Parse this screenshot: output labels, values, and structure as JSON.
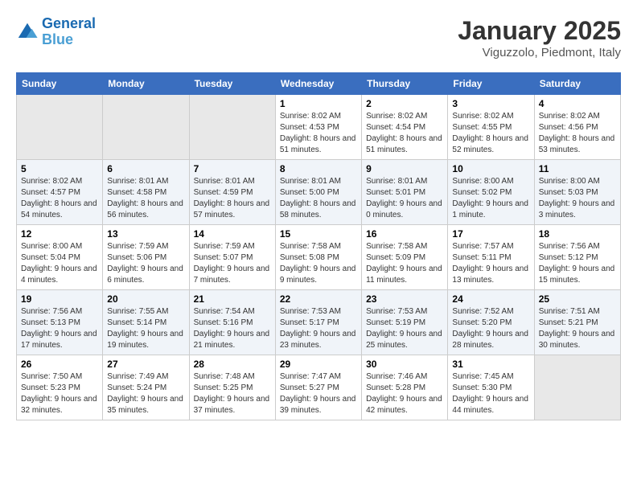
{
  "header": {
    "logo_line1": "General",
    "logo_line2": "Blue",
    "month_title": "January 2025",
    "location": "Viguzzolo, Piedmont, Italy"
  },
  "days_of_week": [
    "Sunday",
    "Monday",
    "Tuesday",
    "Wednesday",
    "Thursday",
    "Friday",
    "Saturday"
  ],
  "weeks": [
    [
      {
        "day": "",
        "info": ""
      },
      {
        "day": "",
        "info": ""
      },
      {
        "day": "",
        "info": ""
      },
      {
        "day": "1",
        "info": "Sunrise: 8:02 AM\nSunset: 4:53 PM\nDaylight: 8 hours and 51 minutes."
      },
      {
        "day": "2",
        "info": "Sunrise: 8:02 AM\nSunset: 4:54 PM\nDaylight: 8 hours and 51 minutes."
      },
      {
        "day": "3",
        "info": "Sunrise: 8:02 AM\nSunset: 4:55 PM\nDaylight: 8 hours and 52 minutes."
      },
      {
        "day": "4",
        "info": "Sunrise: 8:02 AM\nSunset: 4:56 PM\nDaylight: 8 hours and 53 minutes."
      }
    ],
    [
      {
        "day": "5",
        "info": "Sunrise: 8:02 AM\nSunset: 4:57 PM\nDaylight: 8 hours and 54 minutes."
      },
      {
        "day": "6",
        "info": "Sunrise: 8:01 AM\nSunset: 4:58 PM\nDaylight: 8 hours and 56 minutes."
      },
      {
        "day": "7",
        "info": "Sunrise: 8:01 AM\nSunset: 4:59 PM\nDaylight: 8 hours and 57 minutes."
      },
      {
        "day": "8",
        "info": "Sunrise: 8:01 AM\nSunset: 5:00 PM\nDaylight: 8 hours and 58 minutes."
      },
      {
        "day": "9",
        "info": "Sunrise: 8:01 AM\nSunset: 5:01 PM\nDaylight: 9 hours and 0 minutes."
      },
      {
        "day": "10",
        "info": "Sunrise: 8:00 AM\nSunset: 5:02 PM\nDaylight: 9 hours and 1 minute."
      },
      {
        "day": "11",
        "info": "Sunrise: 8:00 AM\nSunset: 5:03 PM\nDaylight: 9 hours and 3 minutes."
      }
    ],
    [
      {
        "day": "12",
        "info": "Sunrise: 8:00 AM\nSunset: 5:04 PM\nDaylight: 9 hours and 4 minutes."
      },
      {
        "day": "13",
        "info": "Sunrise: 7:59 AM\nSunset: 5:06 PM\nDaylight: 9 hours and 6 minutes."
      },
      {
        "day": "14",
        "info": "Sunrise: 7:59 AM\nSunset: 5:07 PM\nDaylight: 9 hours and 7 minutes."
      },
      {
        "day": "15",
        "info": "Sunrise: 7:58 AM\nSunset: 5:08 PM\nDaylight: 9 hours and 9 minutes."
      },
      {
        "day": "16",
        "info": "Sunrise: 7:58 AM\nSunset: 5:09 PM\nDaylight: 9 hours and 11 minutes."
      },
      {
        "day": "17",
        "info": "Sunrise: 7:57 AM\nSunset: 5:11 PM\nDaylight: 9 hours and 13 minutes."
      },
      {
        "day": "18",
        "info": "Sunrise: 7:56 AM\nSunset: 5:12 PM\nDaylight: 9 hours and 15 minutes."
      }
    ],
    [
      {
        "day": "19",
        "info": "Sunrise: 7:56 AM\nSunset: 5:13 PM\nDaylight: 9 hours and 17 minutes."
      },
      {
        "day": "20",
        "info": "Sunrise: 7:55 AM\nSunset: 5:14 PM\nDaylight: 9 hours and 19 minutes."
      },
      {
        "day": "21",
        "info": "Sunrise: 7:54 AM\nSunset: 5:16 PM\nDaylight: 9 hours and 21 minutes."
      },
      {
        "day": "22",
        "info": "Sunrise: 7:53 AM\nSunset: 5:17 PM\nDaylight: 9 hours and 23 minutes."
      },
      {
        "day": "23",
        "info": "Sunrise: 7:53 AM\nSunset: 5:19 PM\nDaylight: 9 hours and 25 minutes."
      },
      {
        "day": "24",
        "info": "Sunrise: 7:52 AM\nSunset: 5:20 PM\nDaylight: 9 hours and 28 minutes."
      },
      {
        "day": "25",
        "info": "Sunrise: 7:51 AM\nSunset: 5:21 PM\nDaylight: 9 hours and 30 minutes."
      }
    ],
    [
      {
        "day": "26",
        "info": "Sunrise: 7:50 AM\nSunset: 5:23 PM\nDaylight: 9 hours and 32 minutes."
      },
      {
        "day": "27",
        "info": "Sunrise: 7:49 AM\nSunset: 5:24 PM\nDaylight: 9 hours and 35 minutes."
      },
      {
        "day": "28",
        "info": "Sunrise: 7:48 AM\nSunset: 5:25 PM\nDaylight: 9 hours and 37 minutes."
      },
      {
        "day": "29",
        "info": "Sunrise: 7:47 AM\nSunset: 5:27 PM\nDaylight: 9 hours and 39 minutes."
      },
      {
        "day": "30",
        "info": "Sunrise: 7:46 AM\nSunset: 5:28 PM\nDaylight: 9 hours and 42 minutes."
      },
      {
        "day": "31",
        "info": "Sunrise: 7:45 AM\nSunset: 5:30 PM\nDaylight: 9 hours and 44 minutes."
      },
      {
        "day": "",
        "info": ""
      }
    ]
  ]
}
